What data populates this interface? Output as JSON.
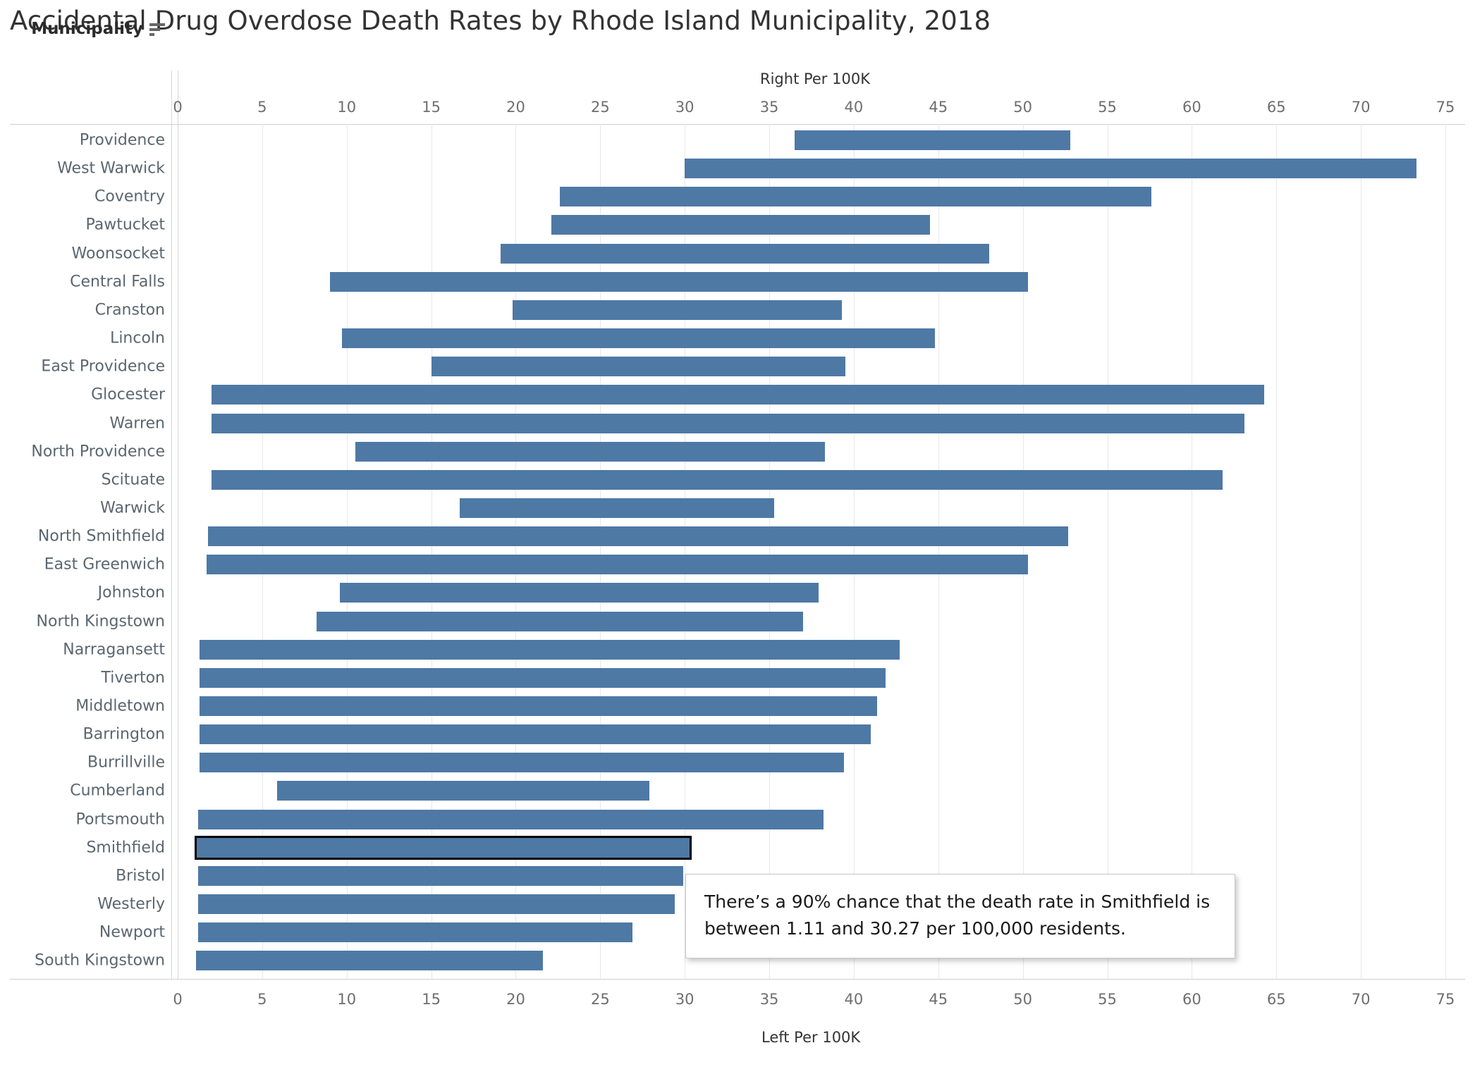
{
  "title": "Accidental Drug Overdose Death Rates by Rhode Island Municipality, 2018",
  "header": {
    "row_header_label": "Municipality",
    "sort_icon": "sort-descending-icon"
  },
  "tooltip": {
    "line1": "There’s a 90% chance that the death rate in Smithfield is",
    "line2": "between 1.11 and 30.27 per 100,000 residents."
  },
  "colors": {
    "bar": "#4e79a5",
    "selected_outline": "#000000",
    "gridline": "#e8e8e8",
    "label_text": "#5a6670",
    "title_text": "#333333"
  },
  "chart_data": {
    "type": "bar",
    "subtype": "range-bar (90% credible interval)",
    "title": "Accidental Drug Overdose Death Rates by Rhode Island Municipality, 2018",
    "xlabel_top": "Right Per 100K",
    "xlabel_bottom": "Left Per 100K",
    "ylabel": "Municipality",
    "xlim": [
      0,
      75
    ],
    "xticks": [
      0,
      5,
      10,
      15,
      20,
      25,
      30,
      35,
      40,
      45,
      50,
      55,
      60,
      65,
      70,
      75
    ],
    "grid": true,
    "legend": null,
    "orientation": "horizontal",
    "categories": [
      "Providence",
      "West Warwick",
      "Coventry",
      "Pawtucket",
      "Woonsocket",
      "Central Falls",
      "Cranston",
      "Lincoln",
      "East Providence",
      "Glocester",
      "Warren",
      "North Providence",
      "Scituate",
      "Warwick",
      "North Smithfield",
      "East Greenwich",
      "Johnston",
      "North Kingstown",
      "Narragansett",
      "Tiverton",
      "Middletown",
      "Barrington",
      "Burrillville",
      "Cumberland",
      "Portsmouth",
      "Smithfield",
      "Bristol",
      "Westerly",
      "Newport",
      "South Kingstown"
    ],
    "series": [
      {
        "name": "Left Per 100K",
        "values": [
          36.5,
          30.0,
          22.6,
          22.1,
          19.1,
          9.0,
          19.8,
          9.7,
          15.0,
          2.0,
          2.0,
          10.5,
          2.0,
          16.7,
          1.8,
          1.7,
          9.6,
          8.2,
          1.3,
          1.3,
          1.3,
          1.3,
          1.3,
          5.9,
          1.2,
          1.11,
          1.2,
          1.2,
          1.2,
          1.1
        ]
      },
      {
        "name": "Right Per 100K",
        "values": [
          52.8,
          73.3,
          57.6,
          44.5,
          48.0,
          50.3,
          39.3,
          44.8,
          39.5,
          64.3,
          63.1,
          38.3,
          61.8,
          35.3,
          52.7,
          50.3,
          37.9,
          37.0,
          42.7,
          41.9,
          41.4,
          41.0,
          39.4,
          27.9,
          38.2,
          30.27,
          29.9,
          29.4,
          26.9,
          21.6
        ]
      }
    ],
    "highlighted_category": "Smithfield"
  }
}
